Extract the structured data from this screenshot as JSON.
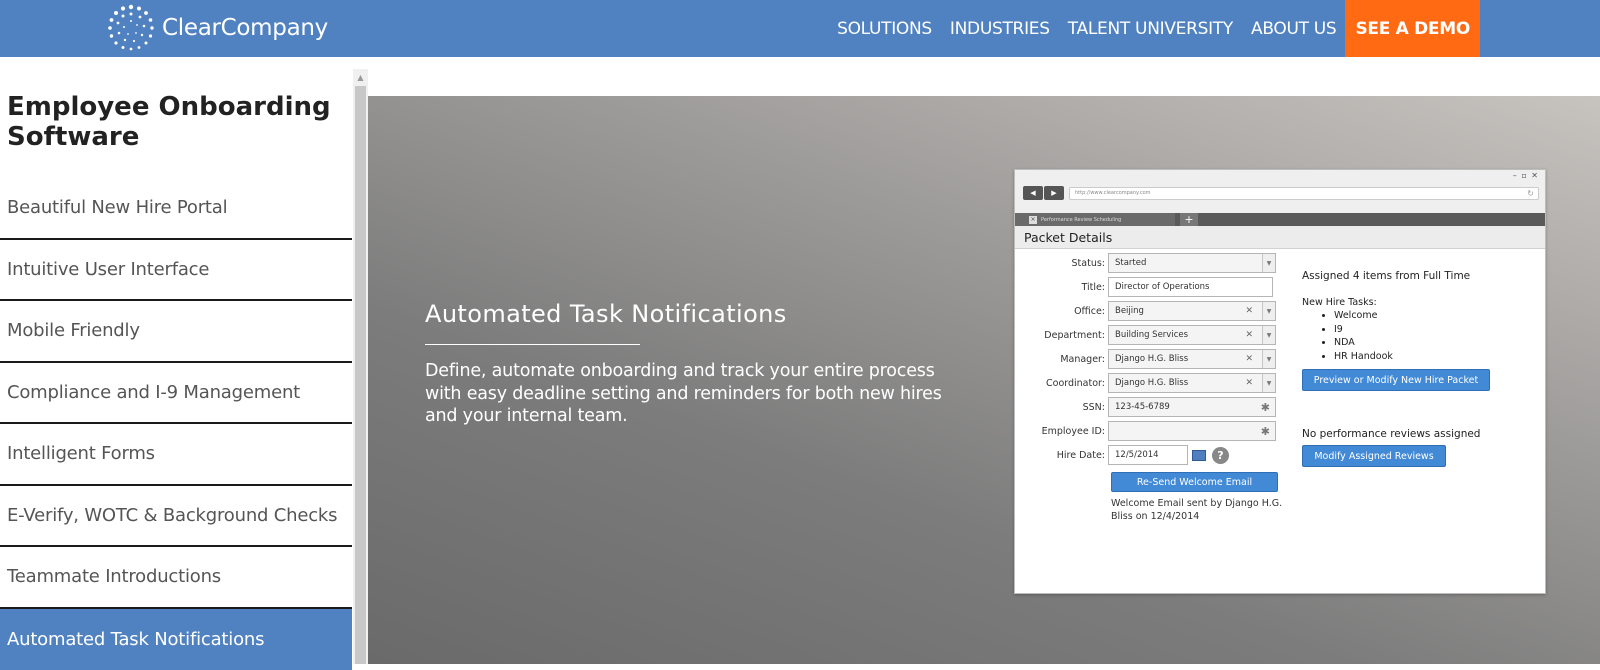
{
  "header": {
    "logo_text": "ClearCompany",
    "nav": [
      "SOLUTIONS",
      "INDUSTRIES",
      "TALENT UNIVERSITY",
      "ABOUT US"
    ],
    "demo_label": "SEE A DEMO",
    "colors": {
      "bar": "#5082c2",
      "demo": "#ff6a13"
    }
  },
  "sidebar": {
    "title": "Employee Onboarding Software",
    "items": [
      "Beautiful New Hire Portal",
      "Intuitive User Interface",
      "Mobile Friendly",
      "Compliance and I-9 Management",
      "Intelligent Forms",
      "E-Verify, WOTC & Background Checks",
      "Teammate Introductions",
      "Automated Task Notifications"
    ],
    "active": "Automated Task Notifications"
  },
  "hero": {
    "heading": "Automated Task Notifications",
    "body": "Define, automate onboarding and track your entire process with easy deadline setting and reminders for both new hires and your internal team."
  },
  "mockup": {
    "url": "http://www.clearcompany.com",
    "tab_label": "Performance Review Scheduling",
    "panel_title": "Packet Details",
    "fields": {
      "status": {
        "label": "Status:",
        "value": "Started"
      },
      "title": {
        "label": "Title:",
        "value": "Director of Operations"
      },
      "office": {
        "label": "Office:",
        "value": "Beijing"
      },
      "department": {
        "label": "Department:",
        "value": "Building Services"
      },
      "manager": {
        "label": "Manager:",
        "value": "Django H.G. Bliss"
      },
      "coordinator": {
        "label": "Coordinator:",
        "value": "Django H.G. Bliss"
      },
      "ssn": {
        "label": "SSN:",
        "value": "123-45-6789"
      },
      "employee_id": {
        "label": "Employee ID:",
        "value": ""
      },
      "hire_date": {
        "label": "Hire Date:",
        "value": "12/5/2014"
      }
    },
    "resend_label": "Re-Send Welcome Email",
    "sent_note": "Welcome Email sent by Django H.G. Bliss on 12/4/2014",
    "assigned_text": "Assigned 4 items from Full Time",
    "new_hire_tasks_label": "New Hire Tasks:",
    "tasks": [
      "Welcome",
      "I9",
      "NDA",
      "HR Handook"
    ],
    "preview_label": "Preview or Modify New Hire Packet",
    "no_reviews_text": "No performance reviews assigned",
    "modify_reviews_label": "Modify Assigned Reviews"
  }
}
